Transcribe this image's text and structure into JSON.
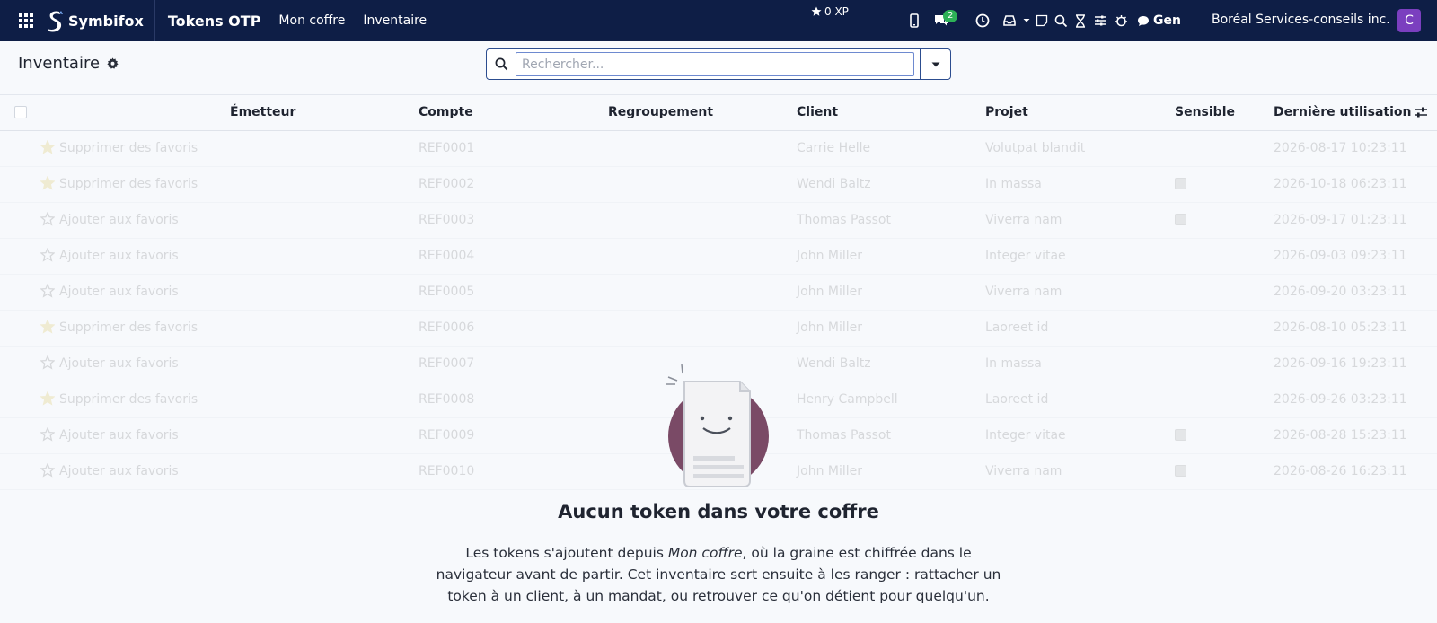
{
  "topbar": {
    "brand": "Symbifox",
    "app_title": "Tokens OTP",
    "nav": [
      "Mon coffre",
      "Inventaire"
    ],
    "xp": "0 XP",
    "messages_count": "2",
    "gen_label": "Gen",
    "company": "Boréal Services-conseils inc.",
    "avatar_letter": "C"
  },
  "control": {
    "title": "Inventaire",
    "search_placeholder": "Rechercher..."
  },
  "table": {
    "columns": [
      "Émetteur",
      "Compte",
      "Regroupement",
      "Client",
      "Projet",
      "Sensible",
      "Dernière utilisation"
    ],
    "rows": [
      {
        "fav": "Supprimer des favoris",
        "starred": true,
        "compte": "REF0001",
        "client": "Carrie Helle",
        "projet": "Volutpat blandit",
        "sensible": false,
        "date": "2026-08-17 10:23:11"
      },
      {
        "fav": "Supprimer des favoris",
        "starred": true,
        "compte": "REF0002",
        "client": "Wendi Baltz",
        "projet": "In massa",
        "sensible": true,
        "date": "2026-10-18 06:23:11"
      },
      {
        "fav": "Ajouter aux favoris",
        "starred": false,
        "compte": "REF0003",
        "client": "Thomas Passot",
        "projet": "Viverra nam",
        "sensible": true,
        "date": "2026-09-17 01:23:11"
      },
      {
        "fav": "Ajouter aux favoris",
        "starred": false,
        "compte": "REF0004",
        "client": "John Miller",
        "projet": "Integer vitae",
        "sensible": false,
        "date": "2026-09-03 09:23:11"
      },
      {
        "fav": "Ajouter aux favoris",
        "starred": false,
        "compte": "REF0005",
        "client": "John Miller",
        "projet": "Viverra nam",
        "sensible": false,
        "date": "2026-09-20 03:23:11"
      },
      {
        "fav": "Supprimer des favoris",
        "starred": true,
        "compte": "REF0006",
        "client": "John Miller",
        "projet": "Laoreet id",
        "sensible": false,
        "date": "2026-08-10 05:23:11"
      },
      {
        "fav": "Ajouter aux favoris",
        "starred": false,
        "compte": "REF0007",
        "client": "Wendi Baltz",
        "projet": "In massa",
        "sensible": false,
        "date": "2026-09-16 19:23:11"
      },
      {
        "fav": "Supprimer des favoris",
        "starred": true,
        "compte": "REF0008",
        "client": "Henry Campbell",
        "projet": "Laoreet id",
        "sensible": false,
        "date": "2026-09-26 03:23:11"
      },
      {
        "fav": "Ajouter aux favoris",
        "starred": false,
        "compte": "REF0009",
        "client": "Thomas Passot",
        "projet": "Integer vitae",
        "sensible": true,
        "date": "2026-08-28 15:23:11"
      },
      {
        "fav": "Ajouter aux favoris",
        "starred": false,
        "compte": "REF0010",
        "client": "John Miller",
        "projet": "Viverra nam",
        "sensible": true,
        "date": "2026-08-26 16:23:11"
      }
    ]
  },
  "empty": {
    "title": "Aucun token dans votre coffre",
    "text_before": "Les tokens s'ajoutent depuis ",
    "text_em": "Mon coffre",
    "text_after": ", où la graine est chiffrée dans le navigateur avant de partir. Cet inventaire sert ensuite à les ranger : rattacher un token à un client, à un mandat, ou retrouver ce qu'on détient pour quelqu'un."
  },
  "colors": {
    "navbar": "#0e1e46",
    "accent": "#2c4d8f",
    "avatar": "#7b3fbf",
    "badge": "#2db157",
    "illustration_circle": "#7a4a66"
  }
}
